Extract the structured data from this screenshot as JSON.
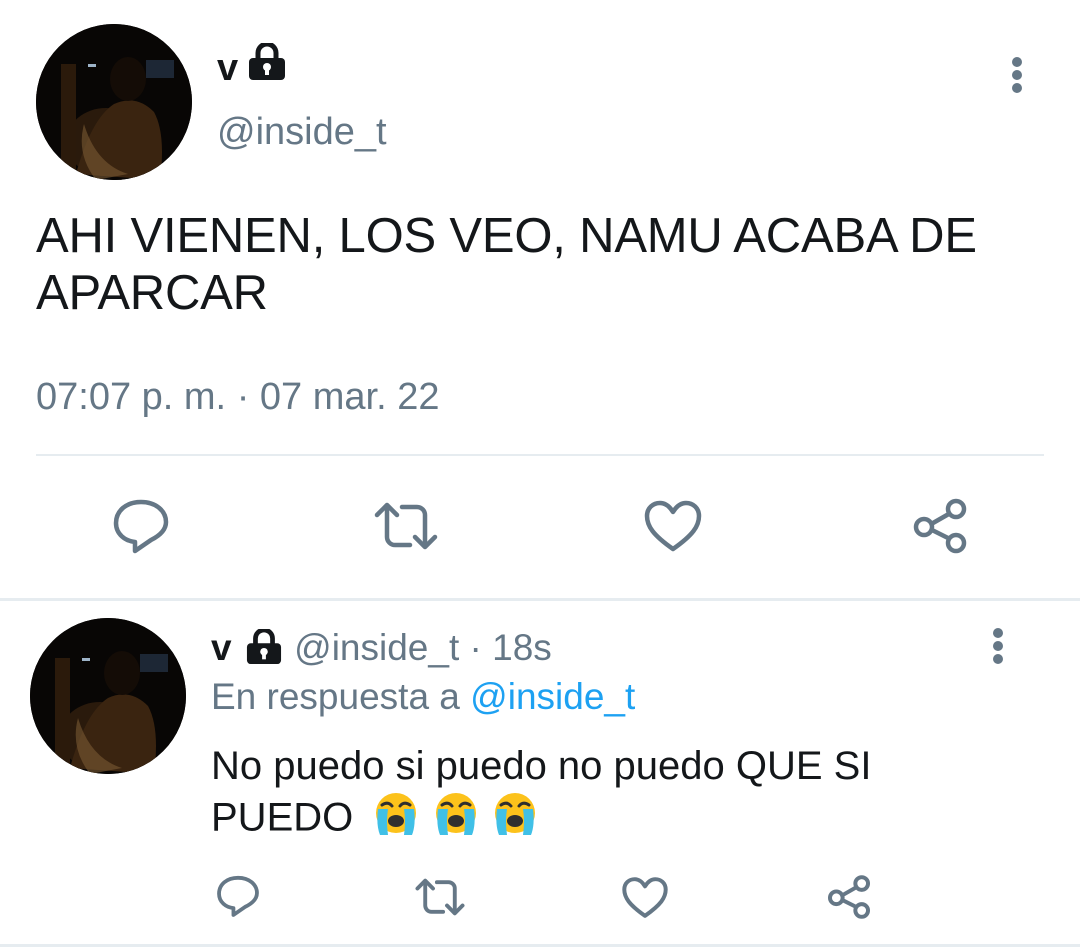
{
  "main_tweet": {
    "author_name": "v",
    "author_handle": "@inside_t",
    "text_line1": "AHI VIENEN, LOS VEO, NAMU ACABA DE",
    "text_line2": "APARCAR",
    "time": "07:07 p. m.",
    "separator": "·",
    "date": "07 mar. 22",
    "icons": {
      "protected": "lock-icon",
      "menu": "more-vertical-icon",
      "actions": [
        "reply-icon",
        "retweet-icon",
        "like-icon",
        "share-icon"
      ]
    }
  },
  "reply_tweet": {
    "author_name": "v",
    "author_handle": "@inside_t",
    "separator": "·",
    "time_ago": "18s",
    "reply_prefix": "En respuesta a",
    "reply_to": "@inside_t",
    "text_line1": "No puedo si puedo no puedo QUE SI",
    "text_line2": "PUEDO",
    "emojis": [
      "loudly-crying-face",
      "loudly-crying-face",
      "loudly-crying-face"
    ],
    "icons": {
      "protected": "lock-icon",
      "menu": "more-vertical-icon",
      "actions": [
        "reply-icon",
        "retweet-icon",
        "like-icon",
        "share-icon"
      ]
    }
  },
  "colors": {
    "text": "#14171a",
    "secondary": "#657786",
    "link": "#1da1f2",
    "divider": "#e6ecf0"
  }
}
